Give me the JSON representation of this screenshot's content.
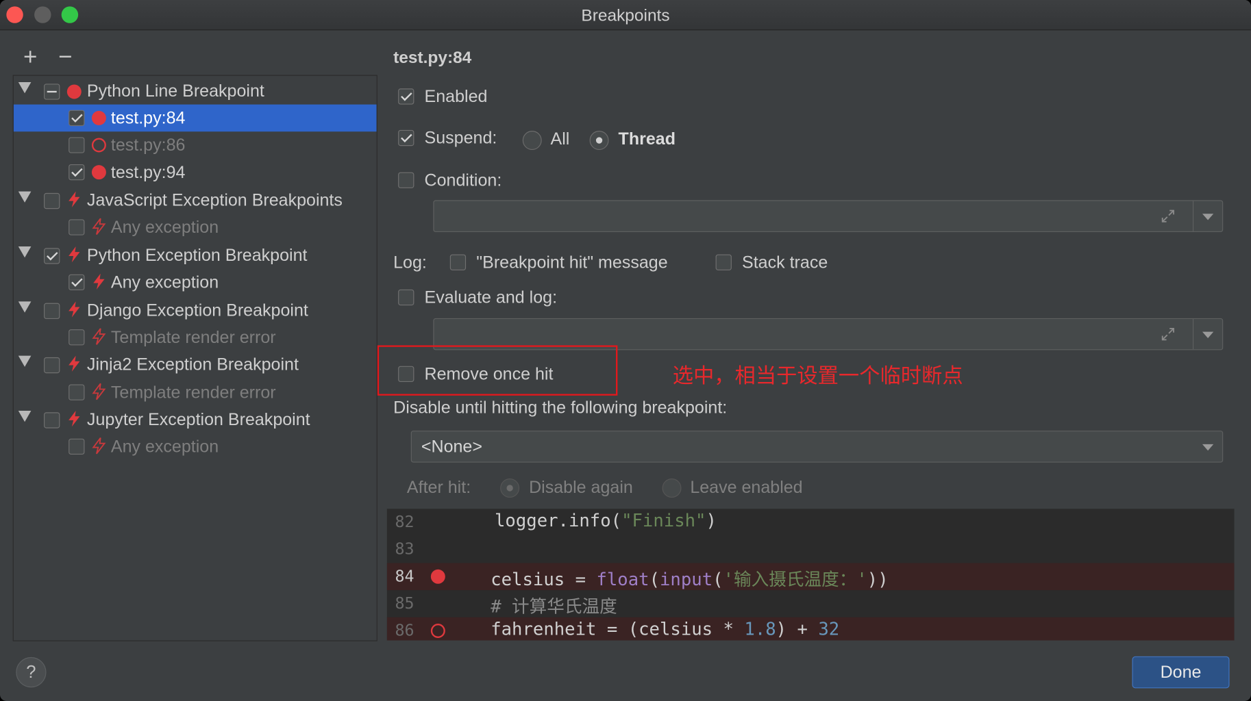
{
  "window": {
    "title": "Breakpoints"
  },
  "toolbar": {
    "add_label": "+",
    "remove_label": "−"
  },
  "tree": [
    {
      "label": "Python Line Breakpoint"
    },
    {
      "label": "test.py:84"
    },
    {
      "label": "test.py:86"
    },
    {
      "label": "test.py:94"
    },
    {
      "label": "JavaScript Exception Breakpoints"
    },
    {
      "label": "Any exception"
    },
    {
      "label": "Python Exception Breakpoint"
    },
    {
      "label": "Any exception"
    },
    {
      "label": "Django Exception Breakpoint"
    },
    {
      "label": "Template render error"
    },
    {
      "label": "Jinja2 Exception Breakpoint"
    },
    {
      "label": "Template render error"
    },
    {
      "label": "Jupyter Exception Breakpoint"
    },
    {
      "label": "Any exception"
    }
  ],
  "details": {
    "title": "test.py:84",
    "enabled_label": "Enabled",
    "suspend_label": "Suspend:",
    "suspend_all": "All",
    "suspend_thread": "Thread",
    "condition_label": "Condition:",
    "log_label": "Log:",
    "log_message": "\"Breakpoint hit\" message",
    "log_stack": "Stack trace",
    "evaluate_label": "Evaluate and log:",
    "remove_once_hit": "Remove once hit",
    "disable_until_label": "Disable until hitting the following breakpoint:",
    "disable_until_value": "<None>",
    "after_hit_label": "After hit:",
    "disable_again": "Disable again",
    "leave_enabled": "Leave enabled"
  },
  "annotation": {
    "note": "选中，相当于设置一个临时断点",
    "color": "#e8282c"
  },
  "code": {
    "lines": [
      {
        "num": "82",
        "indent": "    ",
        "a": "logger.info(",
        "b": "\"Finish\"",
        "c": ")"
      },
      {
        "num": "83"
      },
      {
        "num": "84",
        "p1": "celsius = ",
        "p2": "float",
        "p3": "(",
        "p4": "input",
        "p5": "(",
        "p6": "'输入摄氏温度：'",
        "p7": "))"
      },
      {
        "num": "85",
        "text": "# 计算华氏温度"
      },
      {
        "num": "86",
        "p1": "fahrenheit = (celsius * ",
        "p2": "1.8",
        "p3": ") + ",
        "p4": "32"
      }
    ]
  },
  "footer": {
    "help_label": "?",
    "done_label": "Done"
  },
  "colors": {
    "selection": "#2f65ca",
    "breakpoint": "#e0393e",
    "done_button": "#2c5286"
  }
}
